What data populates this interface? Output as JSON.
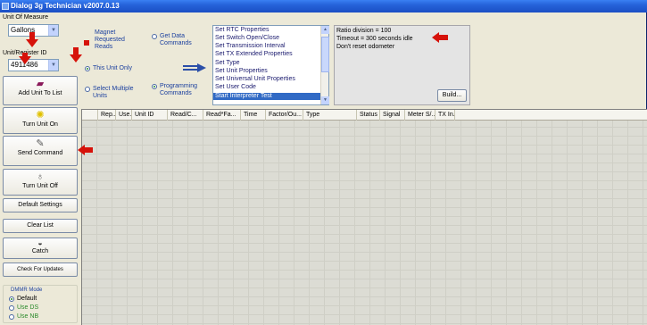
{
  "window": {
    "title": "Dialog 3g Technician v2007.0.13"
  },
  "left": {
    "unit_of_measure_label": "Unit Of Measure",
    "unit_of_measure_value": "Gallons",
    "unit_register_label": "Unit/Register ID",
    "unit_register_value": "4911486",
    "buttons": [
      {
        "label": "Add Unit To List",
        "icon": "book-add-icon"
      },
      {
        "label": "Turn Unit On",
        "icon": "lightbulb-on-icon"
      },
      {
        "label": "Send Command",
        "icon": "send-command-icon"
      },
      {
        "label": "Turn Unit Off",
        "icon": "lightbulb-off-icon"
      },
      {
        "label": "Default Settings"
      },
      {
        "label": "Clear List"
      },
      {
        "label": "Catch",
        "icon": "catch-icon"
      },
      {
        "label": "Check For Updates"
      }
    ],
    "dmmr": {
      "title": "DMMR Mode",
      "options": [
        "Default",
        "Use DS",
        "Use NB"
      ],
      "selected": "Default"
    }
  },
  "modes": {
    "magnet_requested_reads": "Magnet Requested Reads",
    "this_unit_only": "This Unit Only",
    "select_multiple_units": "Select Multiple Units",
    "get_data_commands": "Get Data Commands",
    "programming_commands": "Programming Commands"
  },
  "commands": {
    "items": [
      "Set RTC Properties",
      "Set Switch Open/Close",
      "Set Transmission Interval",
      "Set TX Extended Properties",
      "Set Type",
      "Set Unit Properties",
      "Set Universal Unit Properties",
      "Set User Code",
      "Start Interpreter Test"
    ],
    "selected": "Start Interpreter Test"
  },
  "params": {
    "lines": [
      "Ratio division = 100",
      "Timeout = 300 seconds idle",
      "Don't reset odometer"
    ],
    "build_label": "Build..."
  },
  "grid": {
    "columns": [
      "Rep...",
      "Use...",
      "Unit ID",
      "Read/C...",
      "Read*Fa...",
      "Time",
      "Factor/Ou...",
      "Type",
      "Status",
      "Signal",
      "Meter S/...",
      "TX In..."
    ]
  },
  "colors": {
    "accent_red": "#d6120a",
    "selection_blue": "#316ac5",
    "titlebar_blue": "#2562d9"
  }
}
